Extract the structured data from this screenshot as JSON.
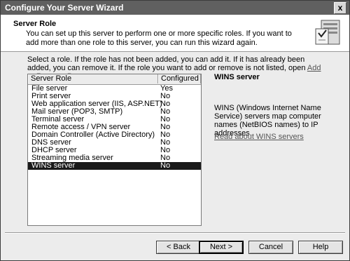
{
  "window": {
    "title": "Configure Your Server Wizard",
    "close_label": "x"
  },
  "header": {
    "title": "Server Role",
    "description": "You can set up this server to perform one or more specific roles. If you want to add more than one role to this server, you can run this wizard again."
  },
  "intro": {
    "text": "Select a role. If the role has not been added, you can add it. If it has already been added, you can remove it. If the role you want to add or remove is not listed, open",
    "link": "Add or Remove Programs",
    "suffix": "."
  },
  "roles_table": {
    "columns": [
      "Server Role",
      "Configured"
    ],
    "rows": [
      {
        "role": "File server",
        "configured": "Yes"
      },
      {
        "role": "Print server",
        "configured": "No"
      },
      {
        "role": "Web application server (IIS, ASP.NET)",
        "configured": "No"
      },
      {
        "role": "Mail server (POP3, SMTP)",
        "configured": "No"
      },
      {
        "role": "Terminal server",
        "configured": "No"
      },
      {
        "role": "Remote access / VPN server",
        "configured": "No"
      },
      {
        "role": "Domain Controller (Active Directory)",
        "configured": "No"
      },
      {
        "role": "DNS server",
        "configured": "No"
      },
      {
        "role": "DHCP server",
        "configured": "No"
      },
      {
        "role": "Streaming media server",
        "configured": "No"
      },
      {
        "role": "WINS server",
        "configured": "No"
      }
    ],
    "selected_index": 10
  },
  "detail": {
    "title": "WINS server",
    "description": "WINS (Windows Internet Name Service) servers map computer names (NetBIOS names) to IP addresses.",
    "link": "Read about WINS servers"
  },
  "buttons": {
    "back": "< Back",
    "next": "Next >",
    "cancel": "Cancel",
    "help": "Help"
  }
}
